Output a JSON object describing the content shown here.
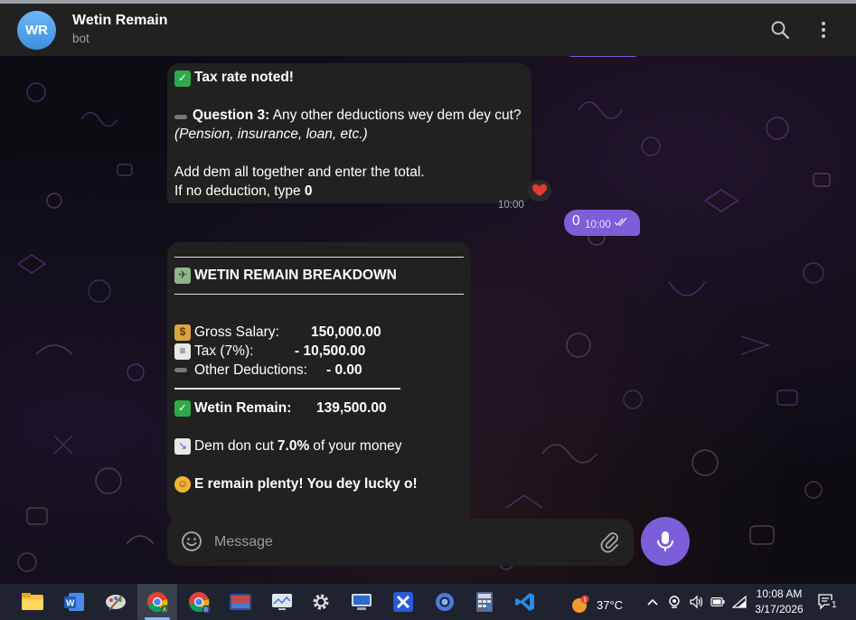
{
  "header": {
    "avatar_initials": "WR",
    "title": "Wetin Remain",
    "subtitle": "bot",
    "search_icon": "search-icon",
    "more_icon": "more-vertical-icon"
  },
  "messages": {
    "first": {
      "line1": "Tax rate noted!",
      "q_label": "Question 3:",
      "q_text": " Any other deductions wey dem dey cut?",
      "q_hint": "(Pension, insurance, loan, etc.)",
      "line4": "Add dem all together and enter the total.",
      "line5_pre": "If no deduction, type ",
      "line5_val": "0",
      "time": "10:00",
      "reaction": "heart"
    },
    "outgoing": {
      "text": "0",
      "time": "10:00"
    },
    "breakdown": {
      "title": "WETIN REMAIN BREAKDOWN",
      "gross_label": "Gross Salary:",
      "gross_value": "150,000.00",
      "tax_label": "Tax (7%):",
      "tax_value": "- 10,500.00",
      "other_label": "Other Deductions:",
      "other_value": "- 0.00",
      "remain_label": "Wetin Remain:",
      "remain_value": "139,500.00",
      "cut_pre": "Dem don cut ",
      "cut_pct": "7.0%",
      "cut_post": " of your money",
      "closing": "E remain plenty! You dey lucky o!"
    }
  },
  "composer": {
    "placeholder": "Message"
  },
  "taskbar": {
    "temperature": "37°C",
    "time": "10:08 AM",
    "date": "3/17/2026",
    "notification_count": "1"
  },
  "colors": {
    "accent": "#7b5fd9",
    "bubble": "#212121",
    "header": "#212121",
    "taskbar": "#1f2330"
  }
}
